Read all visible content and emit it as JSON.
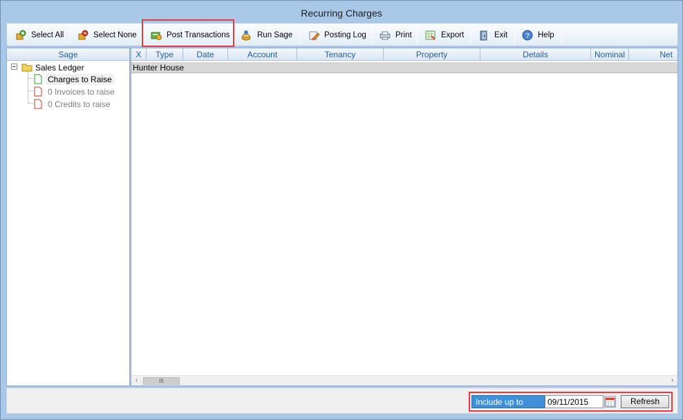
{
  "window": {
    "title": "Recurring Charges"
  },
  "toolbar": {
    "buttons": [
      {
        "label": "Select All",
        "icon": "select-all-icon"
      },
      {
        "label": "Select None",
        "icon": "select-none-icon"
      },
      {
        "label": "Post Transactions",
        "icon": "post-transactions-icon"
      },
      {
        "label": "Run Sage",
        "icon": "run-sage-icon"
      },
      {
        "label": "Posting Log",
        "icon": "posting-log-icon"
      },
      {
        "label": "Print",
        "icon": "print-icon"
      },
      {
        "label": "Export",
        "icon": "export-icon"
      },
      {
        "label": "Exit",
        "icon": "exit-icon"
      },
      {
        "label": "Help",
        "icon": "help-icon"
      }
    ]
  },
  "left_panel": {
    "header": "Sage",
    "tree": {
      "root": "Sales Ledger",
      "children": [
        "Charges to Raise",
        "0 Invoices to raise",
        "0 Credits to raise"
      ]
    }
  },
  "grid": {
    "columns": [
      "X",
      "Type",
      "Date",
      "Account",
      "Tenancy",
      "Property",
      "Details",
      "Nominal",
      "Net"
    ],
    "group_row": "Hunter House",
    "scroll_thumb": "III"
  },
  "footer": {
    "include_label": "Include up to",
    "date_value": "09/11/2015",
    "refresh_label": "Refresh"
  },
  "colors": {
    "highlight_box": "#e5393b",
    "accent": "#3f8fd9",
    "header_text": "#1f5c9c"
  }
}
